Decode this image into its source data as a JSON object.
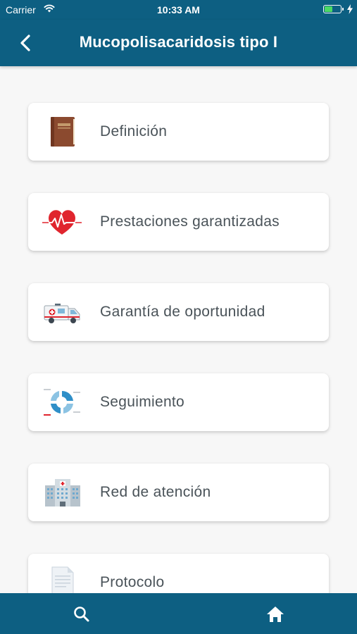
{
  "status_bar": {
    "carrier": "Carrier",
    "time": "10:33 AM",
    "battery_level": 0.5
  },
  "header": {
    "title": "Mucopolisacaridosis tipo I",
    "back_icon": "chevron-left-icon"
  },
  "menu": {
    "items": [
      {
        "label": "Definición",
        "icon": "book-icon"
      },
      {
        "label": "Prestaciones garantizadas",
        "icon": "heart-pulse-icon"
      },
      {
        "label": "Garantía de oportunidad",
        "icon": "ambulance-icon"
      },
      {
        "label": "Seguimiento",
        "icon": "cycle-chart-icon"
      },
      {
        "label": "Red de atención",
        "icon": "hospital-icon"
      },
      {
        "label": "Protocolo",
        "icon": "document-icon"
      }
    ]
  },
  "tab_bar": {
    "items": [
      {
        "icon": "search-icon"
      },
      {
        "icon": "home-icon"
      }
    ]
  },
  "colors": {
    "primary": "#0d5f82",
    "background": "#f7f7f7",
    "card": "#ffffff",
    "text": "#4a5359"
  }
}
